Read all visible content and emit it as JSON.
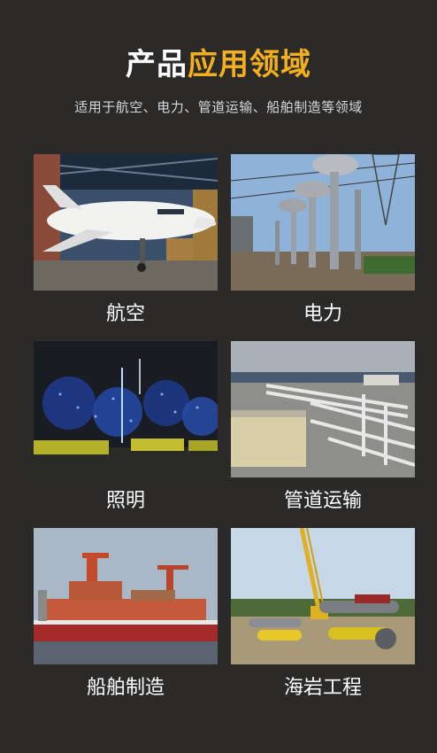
{
  "header": {
    "title_part1": "产品",
    "title_part2": "应用领域",
    "subtitle": "适用于航空、电力、管道运输、船舶制造等领域"
  },
  "colors": {
    "background": "#2b2a29",
    "accent": "#f2b01e",
    "text": "#ffffff"
  },
  "fields": [
    {
      "label": "航空",
      "photo": "aircraft-hangar-photo"
    },
    {
      "label": "电力",
      "photo": "power-substation-photo"
    },
    {
      "label": "照明",
      "photo": "night-lighting-photo"
    },
    {
      "label": "管道运输",
      "photo": "pipeline-photo"
    },
    {
      "label": "船舶制造",
      "photo": "shipyard-photo"
    },
    {
      "label": "海岩工程",
      "photo": "offshore-engineering-photo"
    }
  ]
}
